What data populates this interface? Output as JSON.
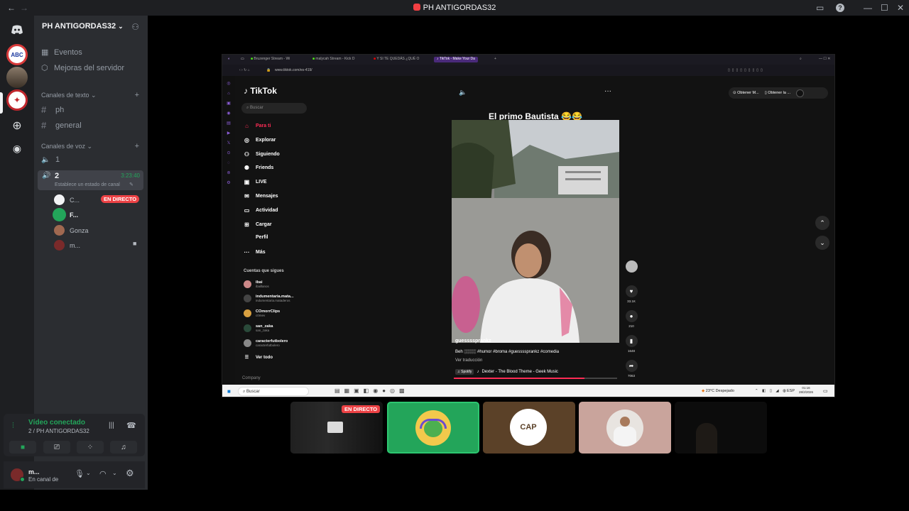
{
  "window": {
    "title": "PH ANTIGORDAS32",
    "back_icon": "←",
    "forward_icon": "→",
    "min_icon": "—",
    "max_icon": "☐",
    "close_icon": "✕"
  },
  "server": {
    "name": "PH ANTIGORDAS32",
    "sidebar_top": [
      {
        "label": "Eventos",
        "icon": "calendar-icon"
      },
      {
        "label": "Mejoras del servidor",
        "icon": "boost-icon"
      }
    ],
    "text_category": "Canales de texto",
    "text_channels": [
      "ph",
      "general"
    ],
    "voice_category": "Canales de voz",
    "voice_channels": [
      {
        "name": "1"
      },
      {
        "name": "2",
        "timer": "3:23:40",
        "status": "Establece un estado de canal"
      }
    ],
    "voice_users": [
      {
        "name": "C...",
        "badge": "EN DIRECTO"
      },
      {
        "name": "F..."
      },
      {
        "name": "Gonza"
      },
      {
        "name": "m..."
      }
    ]
  },
  "voice_panel": {
    "status": "Vídeo conectado",
    "location": "2 / PH ANTIGORDAS32"
  },
  "user_panel": {
    "name": "m...",
    "sub": "En canal de"
  },
  "browser": {
    "tabs": [
      "Bruzenger Stream - Wi",
      "malycah Stream - Kick D",
      "Y SI TE QUEDÁS ¿QUÉ O",
      "TikTok - Make Your Da"
    ],
    "url": "www.tiktok.com/es-419/"
  },
  "tiktok": {
    "logo": "TikTok",
    "search_placeholder": "Buscar",
    "nav": [
      "Para ti",
      "Explorar",
      "Siguiendo",
      "Friends",
      "LIVE",
      "Mensajes",
      "Actividad",
      "Cargar",
      "Perfil",
      "Más"
    ],
    "following_heading": "Cuentas que sigues",
    "accounts": [
      {
        "name": "ibai",
        "handle": "ibaillanos"
      },
      {
        "name": "indumentaria.mata...",
        "handle": "indumentaria.mataderos"
      },
      {
        "name": "COmorrClips",
        "handle": "c0mev"
      },
      {
        "name": "san_zaka",
        "handle": "san_zaka"
      },
      {
        "name": "caracterfutbolero",
        "handle": "caracterfutbolero"
      }
    ],
    "see_all": "Ver todo",
    "company": "Company",
    "top_buttons": [
      "Obtener M...",
      "Obtener la ..."
    ],
    "caption_title": "El primo Bautista 😂😂",
    "author": "guessssprankz",
    "description": "Beh ░░░░  #humor #broma #guessssprankz #comedia",
    "translate": "Ver traducción",
    "music": "Dexter - The Blood Theme - Geek Music",
    "music_source": "Spotify",
    "counts": {
      "likes": "33.1K",
      "comments": "210",
      "saves": "1648",
      "shares": "7063"
    }
  },
  "taskbar": {
    "search": "Buscar",
    "weather": "23°C  Despejado",
    "lang": "ESP",
    "time": "01:16",
    "date": "28/2/2026"
  },
  "tiles": {
    "live_badge": "EN DIRECTO",
    "cap_label": "CAP"
  },
  "colors": {
    "discord_bg": "#2b2d31",
    "rail_bg": "#1e1f22",
    "accent_green": "#23a55a",
    "live_red": "#ed4245",
    "tiktok_pink": "#fe2c55"
  }
}
